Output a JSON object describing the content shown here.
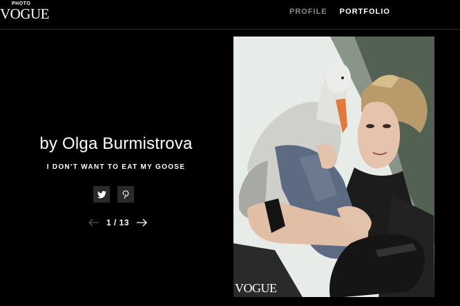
{
  "header": {
    "logo_small": "PHOTO",
    "logo_main": "VOGUE",
    "nav": [
      {
        "label": "PROFILE"
      },
      {
        "label": "PORTFOLIO"
      }
    ]
  },
  "main": {
    "title": "by Olga Burmistrova",
    "subtitle": "I DON'T WANT TO EAT MY GOOSE",
    "social": [
      {
        "icon": "twitter-icon"
      },
      {
        "icon": "pinterest-icon"
      }
    ],
    "pager": {
      "text": "1 / 13"
    }
  },
  "photo": {
    "watermark": "VOGUE"
  }
}
